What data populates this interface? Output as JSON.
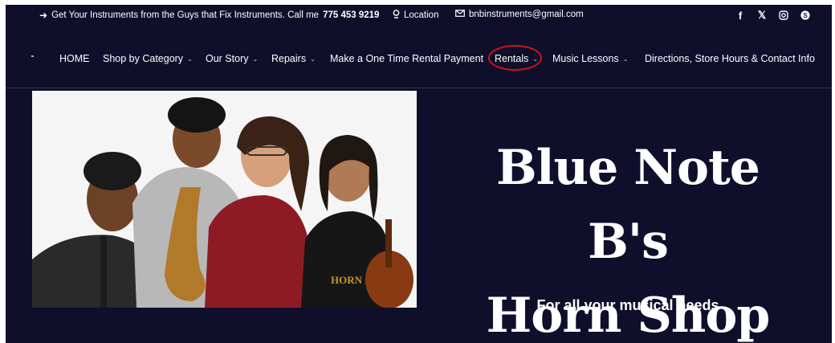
{
  "topbar": {
    "promo_text": "Get Your Instruments from the Guys that Fix Instruments. Call me",
    "phone": "775 453 9219",
    "location_label": "Location",
    "email": "bnbinstruments@gmail.com",
    "social_icons": [
      "facebook-icon",
      "x-icon",
      "instagram-icon",
      "skype-icon"
    ]
  },
  "nav": {
    "items": [
      {
        "label": "HOME"
      },
      {
        "label": "Shop by Category",
        "dropdown": true
      },
      {
        "label": "Our Story",
        "dropdown": true
      },
      {
        "label": "Repairs",
        "dropdown": true
      },
      {
        "label": "Make a One Time Rental Payment"
      },
      {
        "label": "Rentals",
        "dropdown": true,
        "highlighted": true
      },
      {
        "label": "Music Lessons",
        "dropdown": true
      },
      {
        "label": "Directions, Store Hours & Contact Info"
      }
    ]
  },
  "hero": {
    "title_line1": "Blue Note B's",
    "title_line2": "Horn Shop",
    "subtitle": "For all your musical needs",
    "shirt_text": "HORN SHOP"
  },
  "colors": {
    "background": "#0f0f2c",
    "highlight_circle": "#d0121a"
  }
}
